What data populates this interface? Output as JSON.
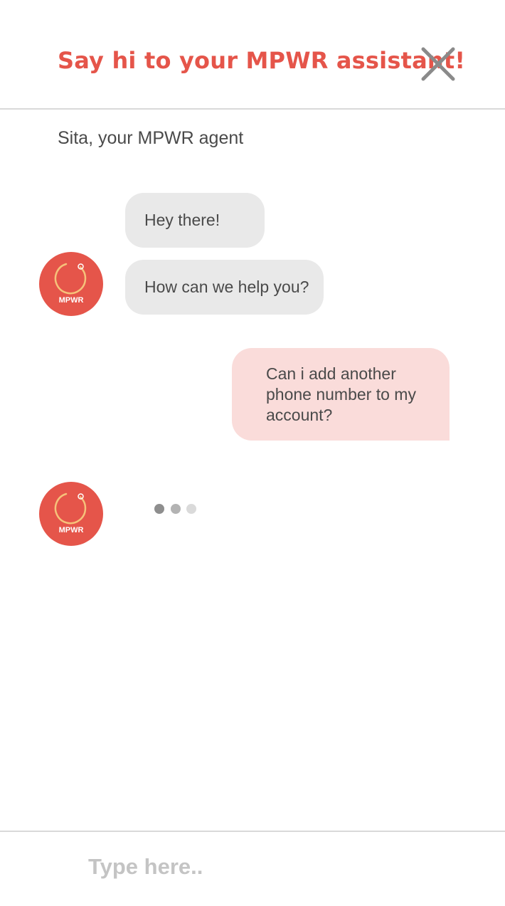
{
  "header": {
    "title": "Say hi to your MPWR assistant!",
    "close_icon": "close-x-icon"
  },
  "agent_label": "Sita, your MPWR agent",
  "avatar": {
    "text": "MPWR",
    "icon": "mpwr-logo-icon"
  },
  "messages": [
    {
      "from": "agent",
      "text": "Hey there!"
    },
    {
      "from": "agent",
      "text": "How can we help you?"
    },
    {
      "from": "user",
      "text": "Can i add another phone number to my account?"
    }
  ],
  "typing_indicator": {
    "icon": "typing-dots-icon"
  },
  "composer": {
    "placeholder": "Type here.."
  },
  "colors": {
    "accent": "#e5554a",
    "agent_bubble": "#e9e9e9",
    "user_bubble": "#fadcda",
    "logo_ring": "#f6c27a"
  }
}
